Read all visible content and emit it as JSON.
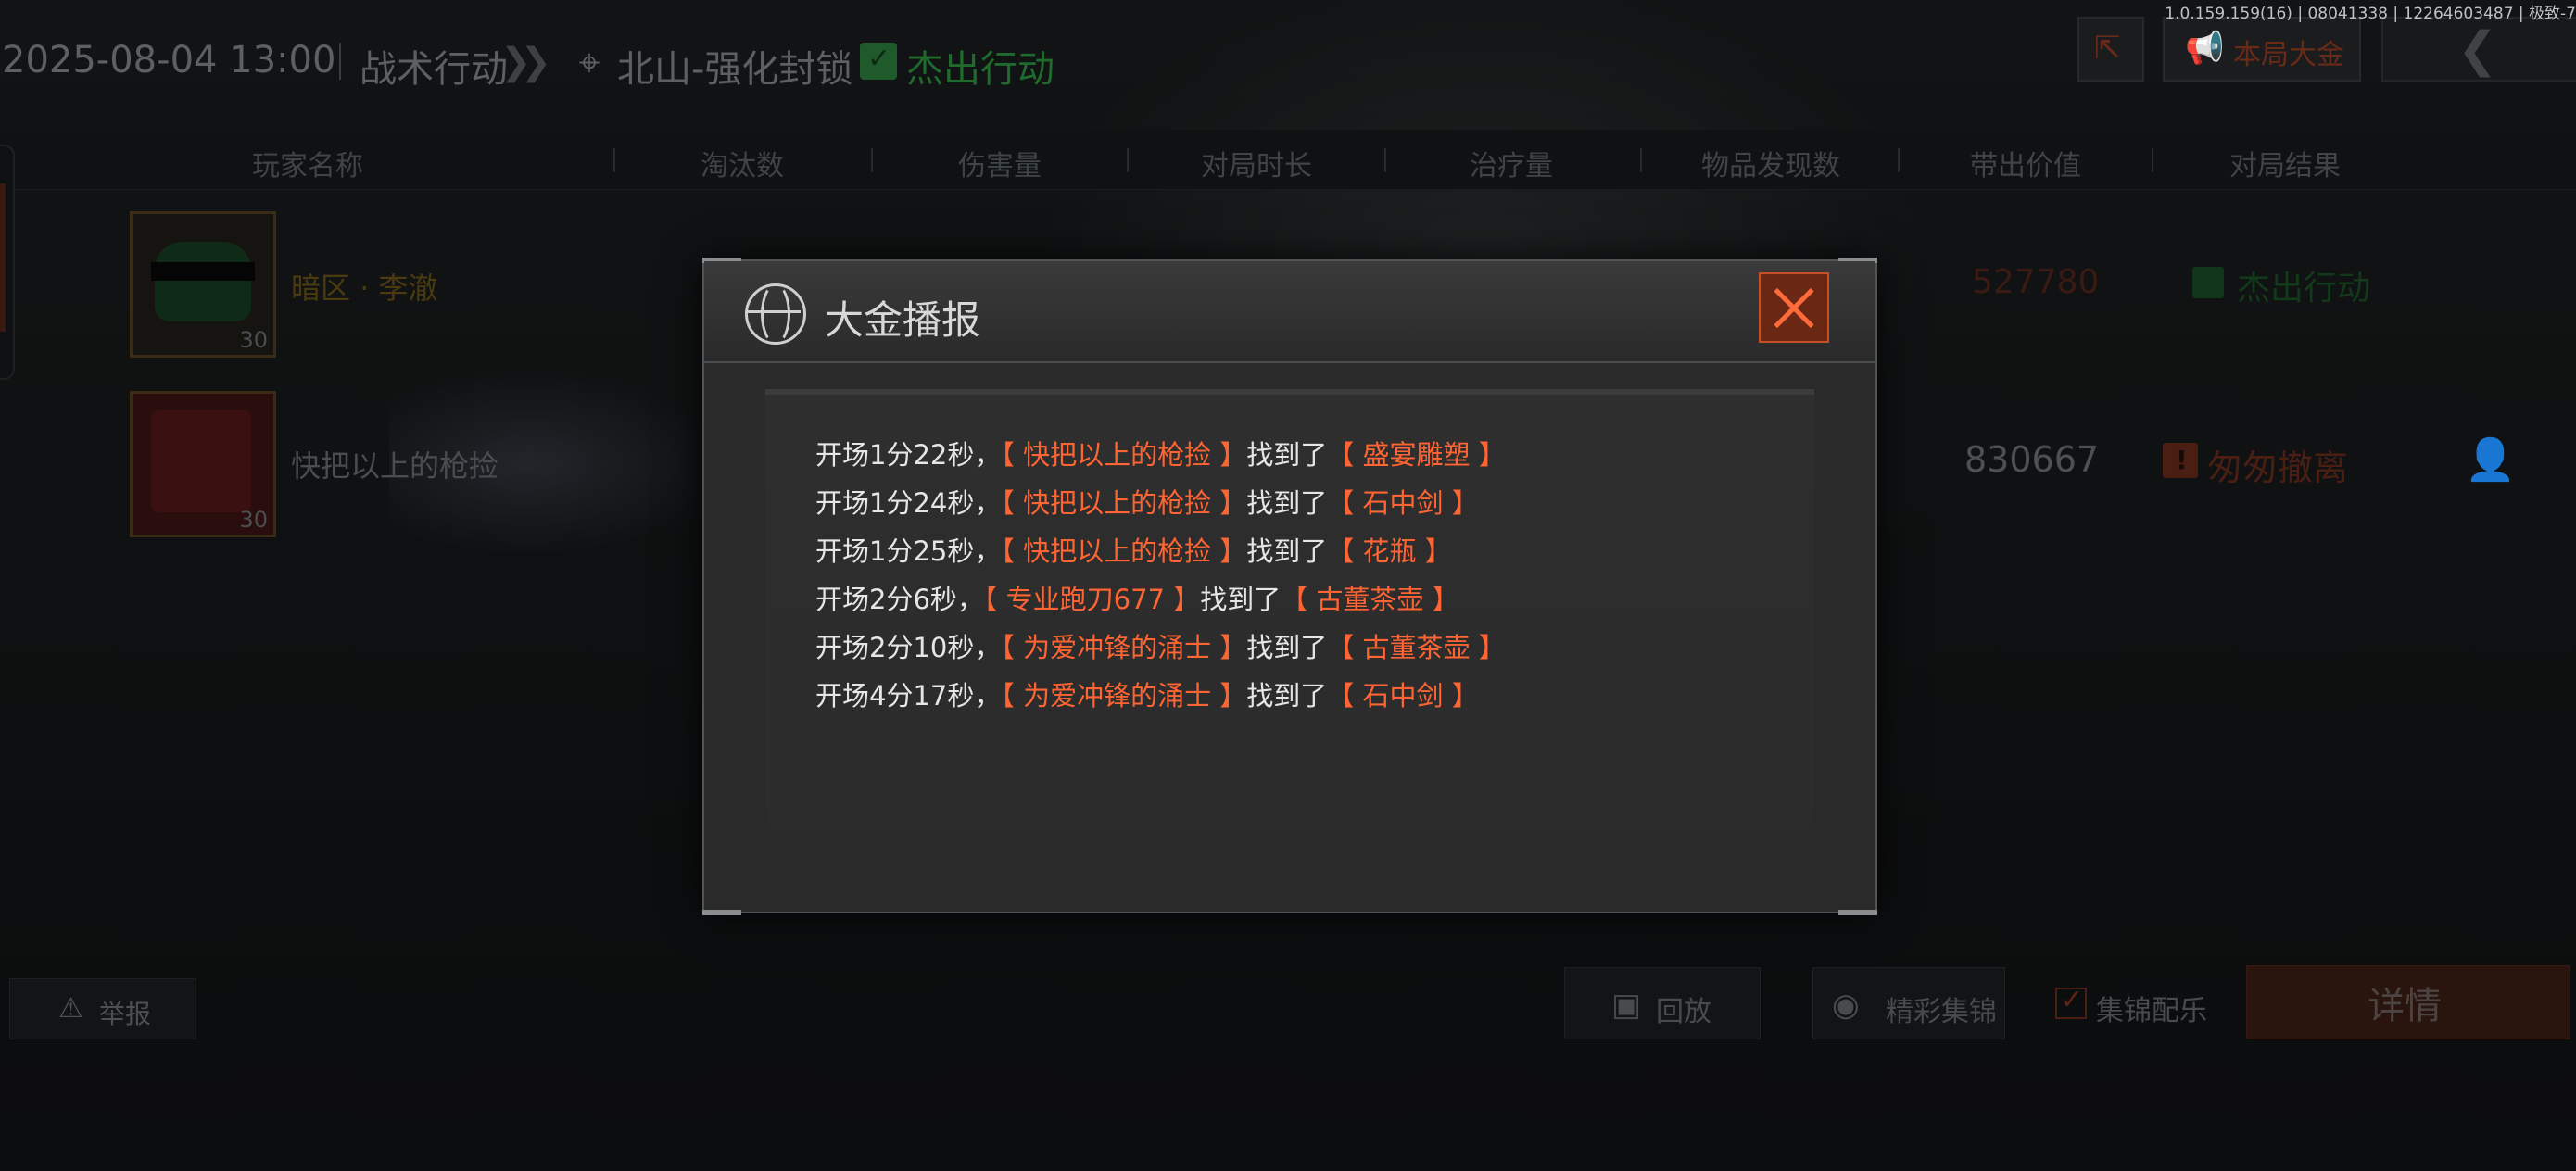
{
  "version_info": "1.0.159.159(16) | 08041338 | 12264603487 | 极致-7",
  "header": {
    "datetime": "2025-08-04 13:00",
    "mode": "战术行动",
    "map": "北山-强化封锁",
    "result": "杰出行动",
    "big_win_button": "本局大金"
  },
  "columns": [
    "玩家名称",
    "淘汰数",
    "伤害量",
    "对局时长",
    "治疗量",
    "物品发现数",
    "带出价值",
    "对局结果"
  ],
  "players": [
    {
      "name": "暗区 · 李澈",
      "level": "30",
      "extract_value": "527780",
      "result": "杰出行动"
    },
    {
      "name": "快把以上的枪捡",
      "level": "30",
      "extract_value": "830667",
      "result": "匆匆撤离"
    }
  ],
  "bottom": {
    "report": "举报",
    "replay": "回放",
    "highlight": "精彩集锦",
    "highlight_music": "集锦配乐",
    "details": "详情"
  },
  "modal": {
    "title": "大金播报",
    "entries": [
      {
        "time": "开场1分22秒，",
        "player": "【 快把以上的枪捡 】",
        "found": "找到了",
        "item": "【 盛宴雕塑 】"
      },
      {
        "time": "开场1分24秒，",
        "player": "【 快把以上的枪捡 】",
        "found": "找到了",
        "item": "【 石中剑 】"
      },
      {
        "time": "开场1分25秒，",
        "player": "【 快把以上的枪捡 】",
        "found": "找到了",
        "item": "【 花瓶 】"
      },
      {
        "time": "开场2分6秒，",
        "player": "【 专业跑刀677 】",
        "found": "找到了",
        "item": "【 古董茶壶 】"
      },
      {
        "time": "开场2分10秒，",
        "player": "【 为爱冲锋的涌士 】",
        "found": "找到了",
        "item": "【 古董茶壶 】"
      },
      {
        "time": "开场4分17秒，",
        "player": "【 为爱冲锋的涌士 】",
        "found": "找到了",
        "item": "【 石中剑 】"
      }
    ]
  },
  "colors": {
    "accent_orange": "#ff6433",
    "success_green": "#1f6a2c",
    "modal_bg": "#2a2a2a"
  }
}
